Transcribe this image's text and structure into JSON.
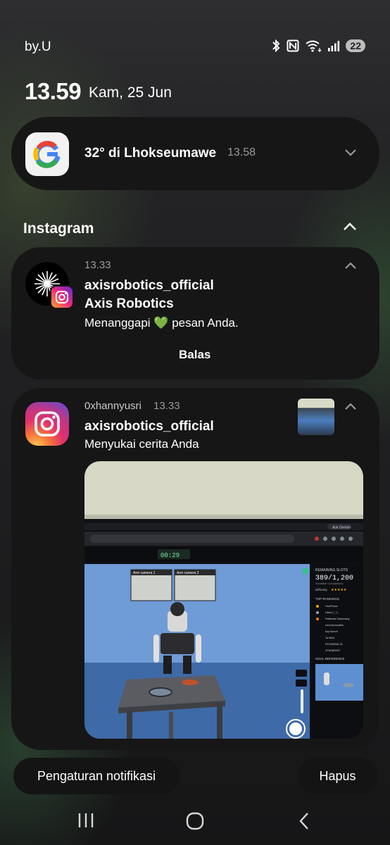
{
  "status_bar": {
    "carrier": "by.U",
    "battery": "22",
    "icons": [
      "bluetooth-icon",
      "nfc-icon",
      "wifi-icon",
      "signal-icon"
    ]
  },
  "lockscreen": {
    "time": "13.59",
    "date": "Kam, 25 Jun"
  },
  "weather": {
    "app_icon": "google-icon",
    "text": "32° di Lhokseumawe",
    "time": "13.58"
  },
  "section": {
    "title": "Instagram"
  },
  "notifications": [
    {
      "time": "13.33",
      "account": "axisrobotics_official",
      "name": "Axis Robotics",
      "message": "Menanggapi 💚 pesan Anda.",
      "action": "Balas"
    },
    {
      "user": "0xhannyusri",
      "time": "13.33",
      "account": "axisrobotics_official",
      "message": "Menyukai cerita Anda"
    }
  ],
  "preview_screen": {
    "top_button": "Ask Gemini",
    "timer": "00:29",
    "remaining_slots_label": "REMAINING SLOTS",
    "remaining_slots_value": "389/1,200",
    "available_completions": "Available Completions",
    "difficulty_label": "Difficulty",
    "difficulty_stars": "★★★★★",
    "top_rankings_label": "TOP RANKINGS",
    "rankings": [
      "HaoPhaoc",
      "Hikal (^_^)",
      "Raffenda Situmeang",
      "robonkurosakio",
      "bop illosch",
      "Ta Minh",
      "ROVARBALTA",
      "ZPaNBB057"
    ],
    "goal_reference_label": "GOAL REFERENCE",
    "camera1": "Arm camera 1",
    "camera2": "Arm camera 2"
  },
  "buttons": {
    "settings": "Pengaturan notifikasi",
    "clear": "Hapus"
  },
  "nav": [
    "recents-icon",
    "home-icon",
    "back-icon"
  ],
  "colors": {
    "card": "#161617",
    "muted_text": "#9a9a9a",
    "heart": "#2ecc71"
  }
}
